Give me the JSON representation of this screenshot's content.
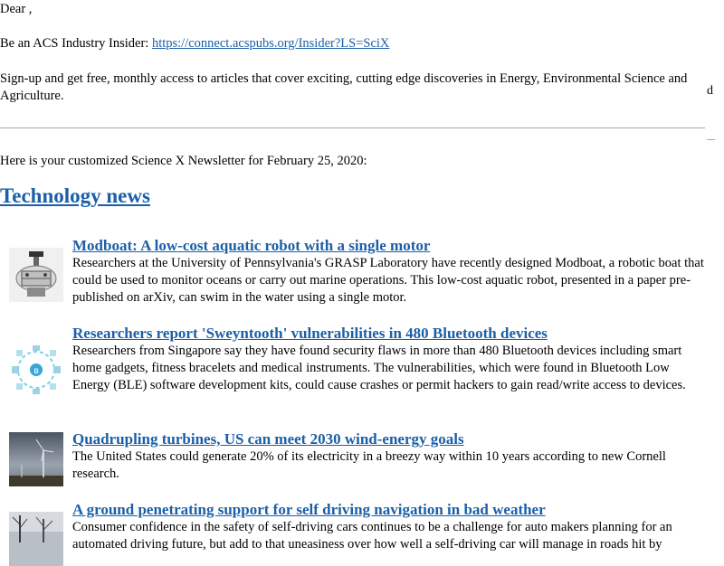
{
  "greeting": "Dear ,",
  "insider": {
    "prefix": "Be an ACS Industry Insider: ",
    "link_text": "https://connect.acspubs.org/Insider?LS=SciX"
  },
  "signup_text": "Sign-up and get free, monthly access to articles that cover exciting, cutting edge discoveries in Energy, Environmental Science and Agriculture.",
  "stray_char": "d",
  "intro": "Here is your customized Science X Newsletter for February 25, 2020:",
  "section_title": "Technology news",
  "articles": [
    {
      "title": "Modboat: A low-cost aquatic robot with a single motor",
      "description": "Researchers at the University of Pennsylvania's GRASP Laboratory have recently designed Modboat, a robotic boat that could be used to monitor oceans or carry out marine operations. This low-cost aquatic robot, presented in a paper pre-published on arXiv, can swim in the water using a single motor.",
      "thumbnail": "robot-boat-photo"
    },
    {
      "title": "Researchers report 'Sweyntooth' vulnerabilities in 480 Bluetooth devices",
      "description": "Researchers from Singapore say they have found security flaws in more than 480 Bluetooth devices including smart home gadgets, fitness bracelets and medical instruments. The vulnerabilities, which were found in Bluetooth Low Energy (BLE) software development kits, could cause crashes or permit hackers to gain read/write access to devices.",
      "thumbnail": "bluetooth-network-diagram"
    },
    {
      "title": "Quadrupling turbines, US can meet 2030 wind-energy goals",
      "description": "The United States could generate 20% of its electricity in a breezy way within 10 years according to new Cornell research.",
      "thumbnail": "wind-turbine-photo"
    },
    {
      "title": "A ground penetrating support for self driving navigation in bad weather",
      "description": "Consumer confidence in the safety of self-driving cars continues to be a challenge for auto makers planning for an automated driving future, but add to that uneasiness over how well a self-driving car will manage in roads hit by",
      "thumbnail": "winter-trees-photo"
    }
  ]
}
